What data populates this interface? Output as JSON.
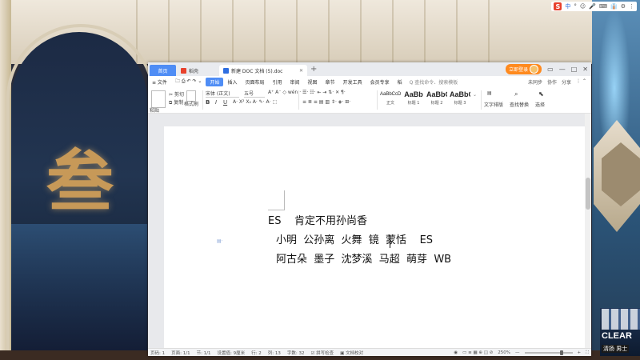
{
  "tray": {
    "ime": "S",
    "items": [
      "中",
      "°",
      "☺",
      "🎤",
      "⌨",
      "👔",
      "⚙",
      "⋮"
    ]
  },
  "window": {
    "tabs": {
      "home": "首页",
      "shell": "稻壳",
      "doc": "新建 DOC 文档 (5).doc",
      "add": "+"
    },
    "login": "立即登录",
    "controls": [
      "▭",
      "—",
      "□",
      "✕"
    ]
  },
  "menu": {
    "file": "≡ 文件",
    "items": [
      "开始",
      "插入",
      "页面布局",
      "引用",
      "审阅",
      "视图",
      "章节",
      "开发工具",
      "会员专享",
      "稻"
    ],
    "active_index": 0,
    "search": "Q 查找命令、搜索模板",
    "right": [
      "未同步",
      "协作",
      "分享"
    ]
  },
  "ribbon": {
    "paste": "粘贴",
    "cut": "剪切",
    "copy": "复制",
    "format_painter": "格式刷",
    "font_name": "宋体 (正文)",
    "font_size": "五号",
    "bold": "B",
    "italic": "I",
    "underline": "U",
    "styles": [
      {
        "preview": "AaBbCcDd",
        "name": "正文",
        "small": true
      },
      {
        "preview": "AaBb",
        "name": "标题 1",
        "small": false
      },
      {
        "preview": "AaBbC",
        "name": "标题 2",
        "small": false
      },
      {
        "preview": "AaBbC",
        "name": "标题 3",
        "small": false
      }
    ],
    "text_tools": "文字排版",
    "find_replace": "查找替换",
    "select": "选择"
  },
  "document": {
    "line1": "ES    肯定不用孙尚香",
    "line2": "小明  公孙离  火舞  镜  蒙恬    ES",
    "line3": "阿古朵  墨子  沈梦溪  马超  萌芽  WB"
  },
  "status": {
    "page_no": "页码: 1",
    "pages": "页面: 1/1",
    "section": "节: 1/1",
    "setting": "设置值: 9厘米",
    "row": "行: 2",
    "col": "列: 13",
    "words": "字数: 32",
    "spell": "拼写检查",
    "proof": "文档校对",
    "zoom": "250%",
    "zoom_fraction": 0.8
  },
  "background": {
    "logo_char": "叁",
    "ad_brand": "CLEAR",
    "ad_sub": "清扬 男士"
  }
}
